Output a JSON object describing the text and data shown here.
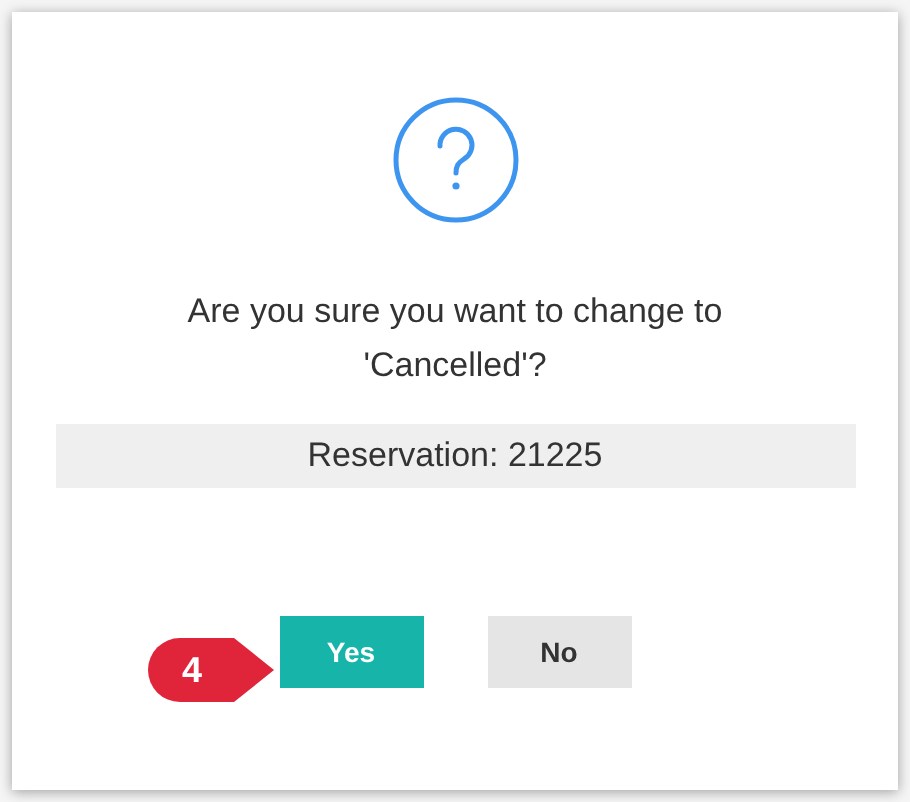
{
  "dialog": {
    "message": "Are you sure you want to change to 'Cancelled'?",
    "detail": "Reservation: 21225",
    "buttons": [
      {
        "label": "Yes",
        "kind": "primary"
      },
      {
        "label": "No",
        "kind": "secondary"
      }
    ]
  },
  "callout": {
    "label": "4"
  }
}
